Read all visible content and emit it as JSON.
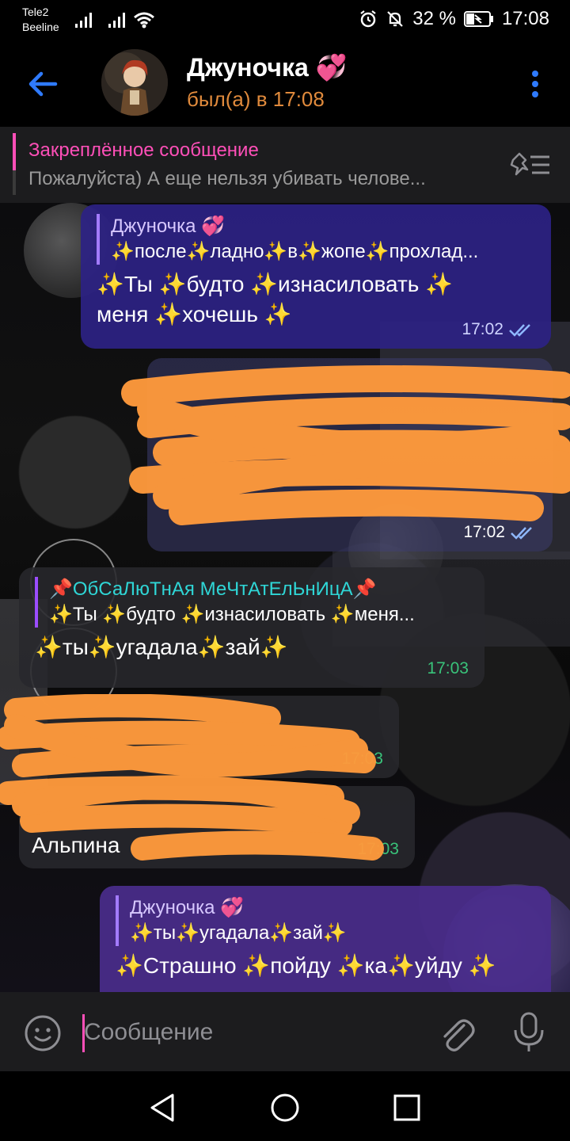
{
  "status_bar": {
    "carrier1": "Tele2",
    "carrier2": "Beeline",
    "battery": "32 %",
    "time": "17:08"
  },
  "header": {
    "title": "Джуночка 💞",
    "status": "был(а) в 17:08"
  },
  "pinned": {
    "title": "Закреплённое сообщение",
    "text": "Пожалуйста) А еще нельзя убивать челове..."
  },
  "messages": [
    {
      "reply_name": "Джуночка 💞",
      "reply_text": "✨после✨ладно✨в✨жопе✨прохлад...",
      "text": "✨Ты ✨будто ✨изнасиловать ✨ меня ✨хочешь ✨",
      "time": "17:02"
    },
    {
      "redacted": true,
      "time": "17:02"
    },
    {
      "reply_name": "📌ОбСаЛюТнАя МеЧтАтЕлЬнИцА📌",
      "reply_text": "✨Ты ✨будто ✨изнасиловать ✨меня...",
      "text": "✨ты✨угадала✨зай✨",
      "time": "17:03"
    },
    {
      "redacted": true,
      "time": "17:03"
    },
    {
      "redacted": true,
      "visible_fragment": "Альпина",
      "time": "17:03"
    },
    {
      "reply_name": "Джуночка 💞",
      "reply_text": "✨ты✨угадала✨зай✨",
      "text": "✨Страшно ✨пойду ✨ка✨уйду ✨"
    }
  ],
  "input": {
    "placeholder": "Сообщение"
  },
  "colors": {
    "accent": "#2f7bff",
    "pink": "#ff4fb8",
    "outgoing_bubble": "#2c2284",
    "incoming_time": "#39c37a",
    "scribble": "#ff9a3c"
  }
}
